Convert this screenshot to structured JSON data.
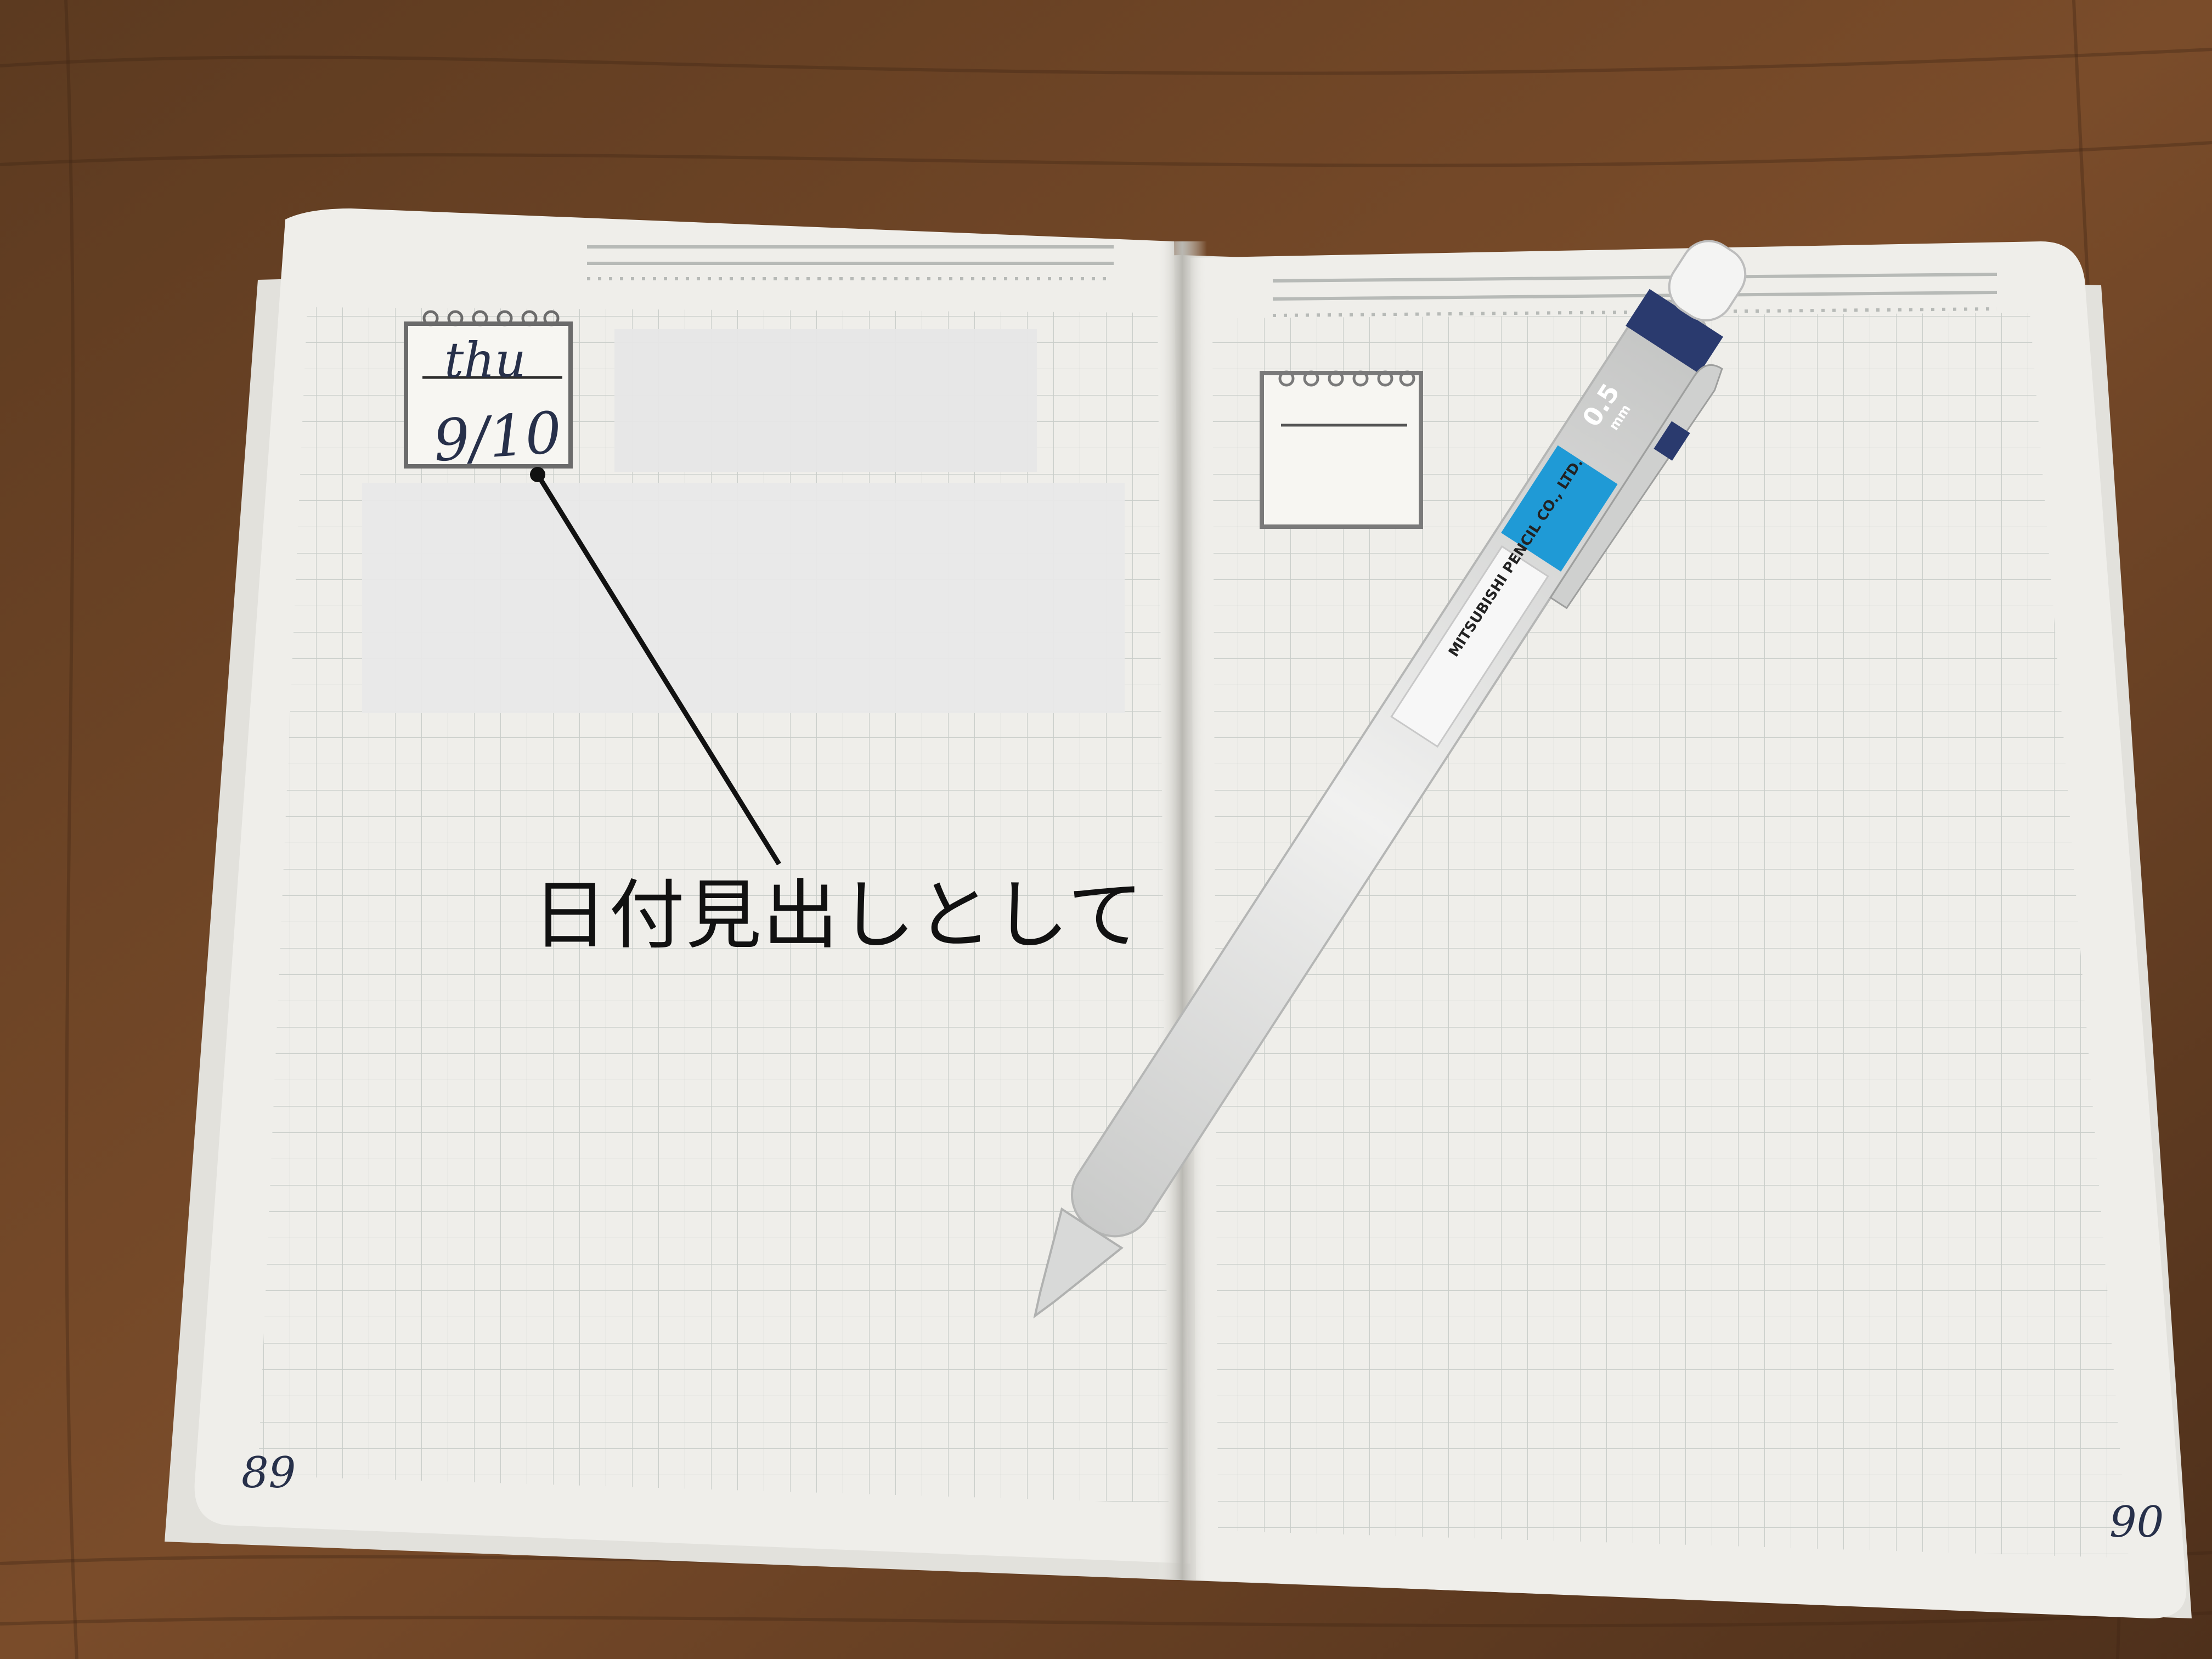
{
  "caption": {
    "text": "日付見出しとして"
  },
  "handwriting": {
    "day": "thu",
    "date": "9/10",
    "left_page_number": "89",
    "right_page_number": "90"
  },
  "pen": {
    "lead_size": "0.5",
    "lead_unit": "mm",
    "maker": "MITSUBISHI PENCIL CO., LTD."
  },
  "colors": {
    "table_wood": "#6e4426",
    "paper": "#efeeea",
    "grid": "#c8ccc8",
    "redaction": "#e6e6e6",
    "pen_body": "#dfe0df",
    "pen_accent": "#2a3a6e",
    "pen_label": "#1f9ad6"
  },
  "icons": [
    "spiral-memo-icon",
    "spiral-memo-icon"
  ]
}
